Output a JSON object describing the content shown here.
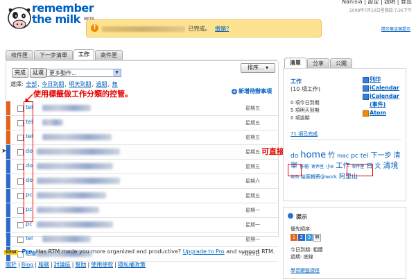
{
  "header": {
    "logo_line1": "remember",
    "logo_line2": "the milk",
    "logo_beta": "BETA",
    "toplinks": "Nanisia | 設定 | 說明 | 登出",
    "datetime": "2008年7月10日星期四 7:26下午"
  },
  "notice": {
    "icon": "!",
    "text": "已完成。",
    "undo": "撤銷?",
    "hide_tips": "隱示無這個提示"
  },
  "tabs": [
    "收件匣",
    "下一步清單",
    "工作",
    "寄件匣"
  ],
  "toolbar": {
    "complete": "完成",
    "postpone": "延遲",
    "more_actions": "更多動作...",
    "sort": "排序...",
    "select_label": "選擇:",
    "select_all": "全部",
    "select_today": "今日到期",
    "select_tomorrow": "明天到期",
    "select_overdue": "過期",
    "select_none": "無",
    "add_task": "新增待辦事項"
  },
  "tasks": [
    {
      "tag": "tel",
      "due": "星期五",
      "prio_color": "#e0651b",
      "blur_w": 70
    },
    {
      "tag": "tel",
      "due": "星期五",
      "prio_color": "#e0651b",
      "blur_w": 30
    },
    {
      "tag": "tel",
      "due": "星期五",
      "prio_color": "#e0651b",
      "blur_w": 100
    },
    {
      "tag": "do",
      "due": "星期五",
      "prio_color": "#2c6ac9",
      "blur_w": 120,
      "selected": true
    },
    {
      "tag": "do",
      "due": "星期五",
      "prio_color": "#2c6ac9",
      "blur_w": 110
    },
    {
      "tag": "do",
      "due": "星期六",
      "prio_color": "#2c6ac9",
      "blur_w": 120
    },
    {
      "tag": "pc",
      "due": "星期五",
      "prio_color": "#2c6ac9",
      "blur_w": 100
    },
    {
      "tag": "pc",
      "due": "星期一",
      "prio_color": "#2c6ac9",
      "blur_w": 90
    },
    {
      "tag": "pc",
      "due": "星期一",
      "prio_color": "#2c6ac9",
      "blur_w": 110
    },
    {
      "tag": "tel",
      "due": "星期一",
      "prio_color": "#2c6ac9",
      "blur_w": 70
    },
    {
      "tag": "結案",
      "due": "7月23日",
      "prio_color": "#2c6ac9",
      "blur_w": 80
    }
  ],
  "annotations": {
    "left": "使用標籤做工作分類的控管。",
    "right": "可直接點選查看該分類的工作項目"
  },
  "promo": {
    "new_badge": "NEW",
    "pro_badge": "Pro",
    "text": "Has RTM made you more organized and productive?",
    "link": "Upgrade to Pro",
    "suffix": "and support RTM."
  },
  "footer": [
    "關於",
    "Blog",
    "服務",
    "討論區",
    "幫助",
    "使用條款",
    "隱私權政策"
  ],
  "right_tabs": [
    "清單",
    "分享",
    "公開"
  ],
  "list_panel": {
    "title": "工作",
    "count": "(10 項工作)",
    "stat_today": "0 項今日到期",
    "stat_tomorrow": "5 項明天到期",
    "stat_overdue": "0 項過期",
    "completed": "71 項已完成",
    "export": [
      "列印",
      "iCalendar",
      "iCalendar (事件)",
      "Atom"
    ]
  },
  "tag_cloud": [
    {
      "t": "do",
      "s": 9
    },
    {
      "t": "home",
      "s": 13
    },
    {
      "t": "竹",
      "s": 10
    },
    {
      "t": "mac",
      "s": 8
    },
    {
      "t": "pc",
      "s": 9
    },
    {
      "t": "tel",
      "s": 9
    },
    {
      "t": "下一步",
      "s": 10
    },
    {
      "t": "清單",
      "s": 10
    },
    {
      "t": "作帳",
      "s": 7
    },
    {
      "t": "寄件匣",
      "s": 6
    },
    {
      "t": "小e",
      "s": 7
    },
    {
      "t": "工作",
      "s": 10
    },
    {
      "t": "收件匣",
      "s": 6
    },
    {
      "t": "日",
      "s": 9
    },
    {
      "t": "文",
      "s": 9
    },
    {
      "t": "清境",
      "s": 11
    },
    {
      "t": "烤肉",
      "s": 6
    },
    {
      "t": "結案轉寄@work",
      "s": 7
    },
    {
      "t": "阿里山",
      "s": 9
    }
  ],
  "tips": {
    "title": "提示",
    "priority_label": "優先順序:",
    "priorities": [
      "1",
      "2",
      "3",
      "無"
    ],
    "today_due": "今日到期: 粗體",
    "overdue": "過期: 底線",
    "more": "學習鍵盤捷徑"
  },
  "colors": {
    "prio1": "#e0651b",
    "prio2": "#2c6ac9",
    "prio3": "#3a9be0",
    "prio_none": "#444444",
    "link": "#0060bf",
    "annotation": "#e60000"
  }
}
